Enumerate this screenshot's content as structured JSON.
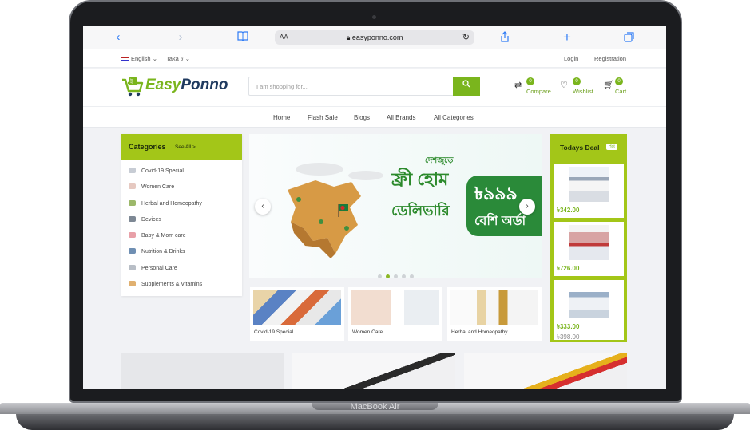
{
  "device": {
    "label": "MacBook Air"
  },
  "browser": {
    "aa_label": "AA",
    "url": "easyponno.com",
    "icons": [
      "chevron-left-icon",
      "chevron-right-icon",
      "book-icon",
      "lock-icon",
      "reload-icon",
      "share-icon",
      "plus-icon",
      "tabs-icon"
    ]
  },
  "topbar": {
    "language": "English",
    "currency": "Taka ৳",
    "login": "Login",
    "registration": "Registration"
  },
  "header": {
    "logo_text_easy": "Easy",
    "logo_text_ponno": "Ponno",
    "search_placeholder": "I am shopping for...",
    "compare_label": "Compare",
    "compare_count": "0",
    "wishlist_label": "Wishlist",
    "wishlist_count": "0",
    "cart_label": "Cart",
    "cart_count": "0"
  },
  "nav": {
    "items": [
      "Home",
      "Flash Sale",
      "Blogs",
      "All Brands",
      "All Categories"
    ]
  },
  "categories": {
    "title": "Categories",
    "see_all": "See All >",
    "items": [
      "Covid-19 Special",
      "Women Care",
      "Herbal and Homeopathy",
      "Devices",
      "Baby & Mom care",
      "Nutrition & Drinks",
      "Personal Care",
      "Supplements & Vitamins"
    ]
  },
  "banner": {
    "line_small": "দেশজুড়ে",
    "line_big": "ফ্রী হোম",
    "line_2": "ডেলিভারি",
    "pill_amount": "৳৯৯৯",
    "pill_text": "বেশি অর্ডা",
    "slide_count": 5,
    "active_slide": 2
  },
  "tiles": [
    {
      "label": "Covid-19 Special"
    },
    {
      "label": "Women Care"
    },
    {
      "label": "Herbal and Homeopathy"
    }
  ],
  "todays_deal": {
    "title": "Todays Deal",
    "hot_label": "Hot",
    "items": [
      {
        "price": "৳342.00"
      },
      {
        "price": "৳726.00"
      },
      {
        "price": "৳333.00",
        "old_price": "৳398.00"
      }
    ]
  },
  "colors": {
    "brand_green": "#7ab51d",
    "lime": "#a3c618",
    "logo_dark": "#1f3a5f"
  }
}
